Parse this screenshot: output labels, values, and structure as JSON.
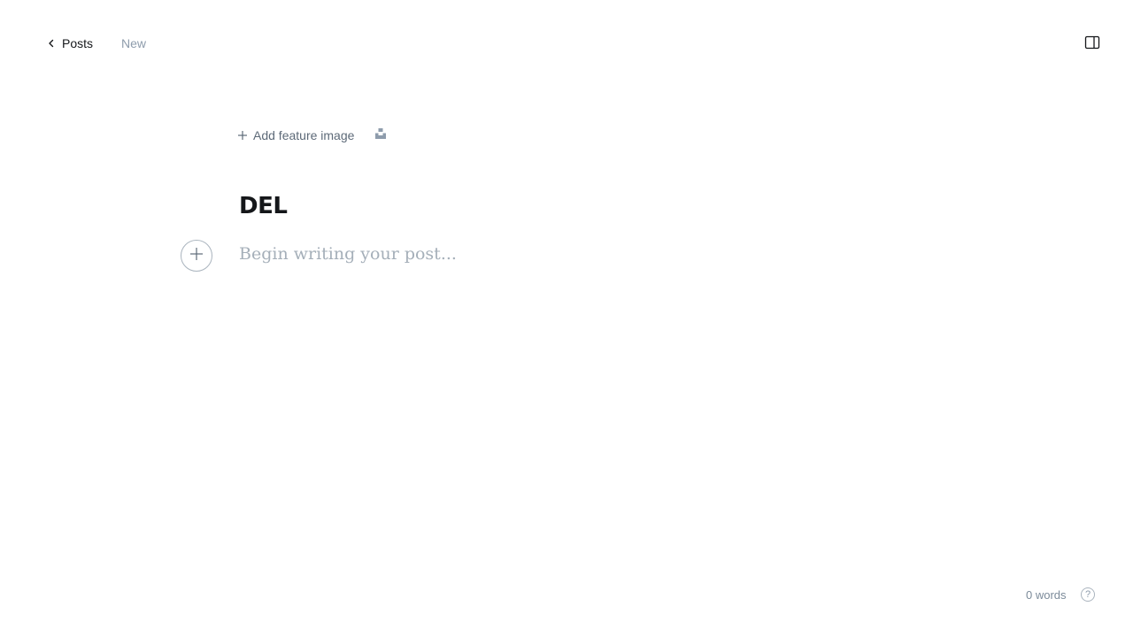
{
  "header": {
    "back_label": "Posts",
    "status": "New",
    "back_icon": "chevron-left-icon",
    "settings_icon": "sidebar-toggle-icon"
  },
  "feature_image": {
    "add_label": "Add feature image",
    "add_icon": "plus-icon",
    "unsplash_icon": "unsplash-icon"
  },
  "post": {
    "title": "DEL",
    "body_placeholder": "Begin writing your post..."
  },
  "editor": {
    "plus_icon": "plus-icon"
  },
  "footer": {
    "word_count": "0 words",
    "help_label": "?"
  },
  "colors": {
    "text_primary": "#15171a",
    "text_muted": "#8e9cac",
    "placeholder": "#a5afb9",
    "border": "#aab4be",
    "background": "#ffffff"
  }
}
